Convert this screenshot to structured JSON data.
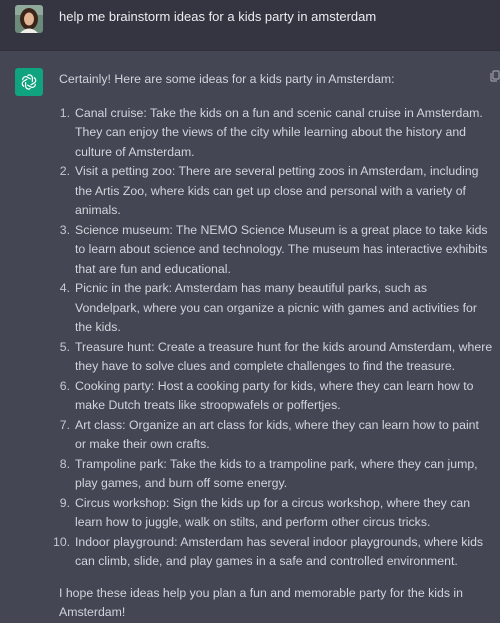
{
  "user_message": {
    "text": "help me brainstorm ideas for a kids party in amsterdam"
  },
  "assistant_message": {
    "intro": "Certainly! Here are some ideas for a kids party in Amsterdam:",
    "ideas": [
      {
        "number": "1.",
        "text": "Canal cruise: Take the kids on a fun and scenic canal cruise in Amsterdam. They can enjoy the views of the city while learning about the history and culture of Amsterdam."
      },
      {
        "number": "2.",
        "text": "Visit a petting zoo: There are several petting zoos in Amsterdam, including the Artis Zoo, where kids can get up close and personal with a variety of animals."
      },
      {
        "number": "3.",
        "text": "Science museum: The NEMO Science Museum is a great place to take kids to learn about science and technology. The museum has interactive exhibits that are fun and educational."
      },
      {
        "number": "4.",
        "text": "Picnic in the park: Amsterdam has many beautiful parks, such as Vondelpark, where you can organize a picnic with games and activities for the kids."
      },
      {
        "number": "5.",
        "text": "Treasure hunt: Create a treasure hunt for the kids around Amsterdam, where they have to solve clues and complete challenges to find the treasure."
      },
      {
        "number": "6.",
        "text": "Cooking party: Host a cooking party for kids, where they can learn how to make Dutch treats like stroopwafels or poffertjes."
      },
      {
        "number": "7.",
        "text": "Art class: Organize an art class for kids, where they can learn how to paint or make their own crafts."
      },
      {
        "number": "8.",
        "text": "Trampoline park: Take the kids to a trampoline park, where they can jump, play games, and burn off some energy."
      },
      {
        "number": "9.",
        "text": "Circus workshop: Sign the kids up for a circus workshop, where they can learn how to juggle, walk on stilts, and perform other circus tricks."
      },
      {
        "number": "10.",
        "text": "Indoor playground: Amsterdam has several indoor playgrounds, where kids can climb, slide, and play games in a safe and controlled environment."
      }
    ],
    "outro": "I hope these ideas help you plan a fun and memorable party for the kids in Amsterdam!"
  },
  "icons": {
    "user_avatar": "user-avatar-photo",
    "assistant_avatar": "openai-logo-icon",
    "copy": "copy-icon"
  },
  "colors": {
    "user_bg": "#343541",
    "assistant_bg": "#444654",
    "brand": "#10a37f",
    "text": "#d1d5db"
  }
}
